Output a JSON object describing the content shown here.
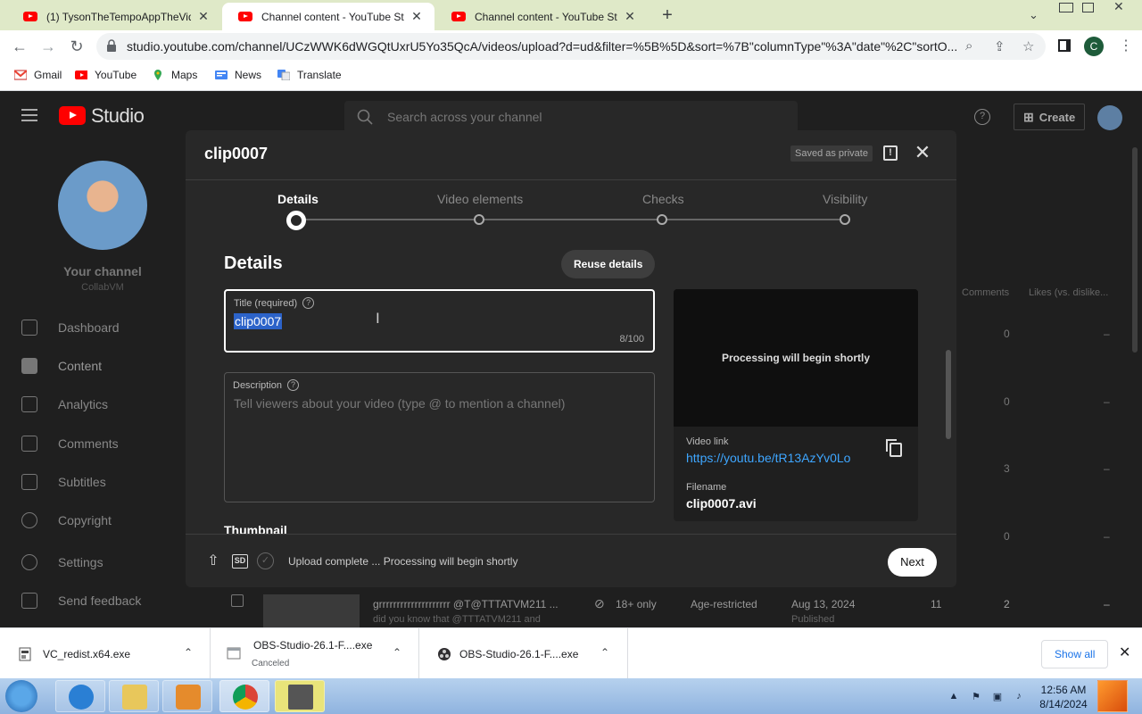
{
  "browser": {
    "tabs": [
      {
        "label": "(1) TysonTheTempoAppTheVideo",
        "active": false
      },
      {
        "label": "Channel content - YouTube Studio",
        "active": true
      },
      {
        "label": "Channel content - YouTube Studio",
        "active": false
      }
    ],
    "url": "studio.youtube.com/channel/UCzWWK6dWGQtUxrU5Yo35QcA/videos/upload?d=ud&filter=%5B%5D&sort=%7B\"columnType\"%3A\"date\"%2C\"sortO...",
    "profile_initial": "C",
    "bookmarks": [
      "Gmail",
      "YouTube",
      "Maps",
      "News",
      "Translate"
    ]
  },
  "studio": {
    "logo_text": "Studio",
    "search_placeholder": "Search across your channel",
    "create_label": "Create",
    "channel_name": "Your channel",
    "channel_sub": "CollabVM",
    "nav": [
      {
        "label": "Dashboard",
        "active": false
      },
      {
        "label": "Content",
        "active": true
      },
      {
        "label": "Analytics",
        "active": false
      },
      {
        "label": "Comments",
        "active": false
      },
      {
        "label": "Subtitles",
        "active": false
      },
      {
        "label": "Copyright",
        "active": false
      },
      {
        "label": "Settings",
        "active": false
      },
      {
        "label": "Send feedback",
        "active": false
      }
    ],
    "table_headers": {
      "comments": "Comments",
      "likes": "Likes (vs. dislike..."
    },
    "rows": [
      {
        "comments": "0",
        "likes": "–"
      },
      {
        "comments": "0",
        "likes": "–"
      },
      {
        "comments": "3",
        "likes": "–"
      },
      {
        "comments": "0",
        "likes": "–"
      },
      {
        "comments": "2",
        "likes": "–"
      }
    ],
    "bottom_row": {
      "title": "grrrrrrrrrrrrrrrrrrrr @T@TTTATVM211 ...",
      "desc": "did you know that @TTTATVM211 and",
      "restriction_label": "18+ only",
      "restriction": "Age-restricted",
      "date": "Aug 13, 2024",
      "date_sub": "Published",
      "views": "11",
      "comments": "2",
      "likes": "–"
    }
  },
  "modal": {
    "title": "clip0007",
    "saved_badge": "Saved as private",
    "steps": [
      {
        "label": "Details",
        "active": true
      },
      {
        "label": "Video elements",
        "active": false
      },
      {
        "label": "Checks",
        "active": false
      },
      {
        "label": "Visibility",
        "active": false
      }
    ],
    "section_heading": "Details",
    "reuse_label": "Reuse details",
    "title_field": {
      "label": "Title (required)",
      "value": "clip0007",
      "count": "8/100"
    },
    "description_field": {
      "label": "Description",
      "placeholder": "Tell viewers about your video (type @ to mention a channel)"
    },
    "thumbnail_heading": "Thumbnail",
    "preview": {
      "processing": "Processing will begin shortly",
      "link_label": "Video link",
      "link": "https://youtu.be/tR13AzYv0Lo",
      "filename_label": "Filename",
      "filename": "clip0007.avi"
    },
    "footer": {
      "sd_label": "SD",
      "status": "Upload complete ... Processing will begin shortly",
      "next_label": "Next"
    }
  },
  "downloads": {
    "items": [
      {
        "name": "VC_redist.x64.exe",
        "sub": ""
      },
      {
        "name": "OBS-Studio-26.1-F....exe",
        "sub": "Canceled"
      },
      {
        "name": "OBS-Studio-26.1-F....exe",
        "sub": ""
      }
    ],
    "show_all": "Show all"
  },
  "taskbar": {
    "time": "12:56 AM",
    "date": "8/14/2024"
  },
  "colors": {
    "accent_link": "#3ea6ff",
    "selection": "#2c63c9",
    "yt_red": "#ff0000"
  }
}
